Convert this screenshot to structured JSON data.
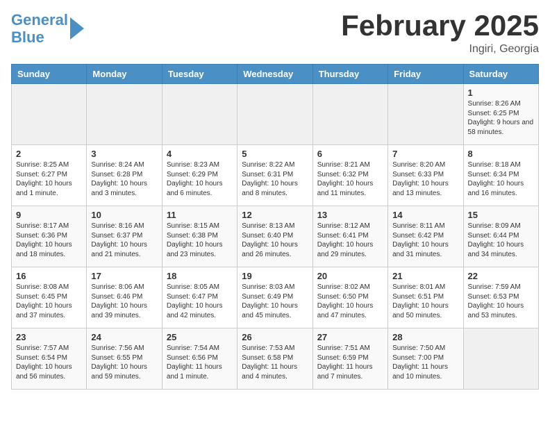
{
  "header": {
    "logo_line1": "General",
    "logo_line2": "Blue",
    "month": "February 2025",
    "location": "Ingiri, Georgia"
  },
  "days_of_week": [
    "Sunday",
    "Monday",
    "Tuesday",
    "Wednesday",
    "Thursday",
    "Friday",
    "Saturday"
  ],
  "weeks": [
    [
      {
        "num": "",
        "info": ""
      },
      {
        "num": "",
        "info": ""
      },
      {
        "num": "",
        "info": ""
      },
      {
        "num": "",
        "info": ""
      },
      {
        "num": "",
        "info": ""
      },
      {
        "num": "",
        "info": ""
      },
      {
        "num": "1",
        "info": "Sunrise: 8:26 AM\nSunset: 6:25 PM\nDaylight: 9 hours and 58 minutes."
      }
    ],
    [
      {
        "num": "2",
        "info": "Sunrise: 8:25 AM\nSunset: 6:27 PM\nDaylight: 10 hours and 1 minute."
      },
      {
        "num": "3",
        "info": "Sunrise: 8:24 AM\nSunset: 6:28 PM\nDaylight: 10 hours and 3 minutes."
      },
      {
        "num": "4",
        "info": "Sunrise: 8:23 AM\nSunset: 6:29 PM\nDaylight: 10 hours and 6 minutes."
      },
      {
        "num": "5",
        "info": "Sunrise: 8:22 AM\nSunset: 6:31 PM\nDaylight: 10 hours and 8 minutes."
      },
      {
        "num": "6",
        "info": "Sunrise: 8:21 AM\nSunset: 6:32 PM\nDaylight: 10 hours and 11 minutes."
      },
      {
        "num": "7",
        "info": "Sunrise: 8:20 AM\nSunset: 6:33 PM\nDaylight: 10 hours and 13 minutes."
      },
      {
        "num": "8",
        "info": "Sunrise: 8:18 AM\nSunset: 6:34 PM\nDaylight: 10 hours and 16 minutes."
      }
    ],
    [
      {
        "num": "9",
        "info": "Sunrise: 8:17 AM\nSunset: 6:36 PM\nDaylight: 10 hours and 18 minutes."
      },
      {
        "num": "10",
        "info": "Sunrise: 8:16 AM\nSunset: 6:37 PM\nDaylight: 10 hours and 21 minutes."
      },
      {
        "num": "11",
        "info": "Sunrise: 8:15 AM\nSunset: 6:38 PM\nDaylight: 10 hours and 23 minutes."
      },
      {
        "num": "12",
        "info": "Sunrise: 8:13 AM\nSunset: 6:40 PM\nDaylight: 10 hours and 26 minutes."
      },
      {
        "num": "13",
        "info": "Sunrise: 8:12 AM\nSunset: 6:41 PM\nDaylight: 10 hours and 29 minutes."
      },
      {
        "num": "14",
        "info": "Sunrise: 8:11 AM\nSunset: 6:42 PM\nDaylight: 10 hours and 31 minutes."
      },
      {
        "num": "15",
        "info": "Sunrise: 8:09 AM\nSunset: 6:44 PM\nDaylight: 10 hours and 34 minutes."
      }
    ],
    [
      {
        "num": "16",
        "info": "Sunrise: 8:08 AM\nSunset: 6:45 PM\nDaylight: 10 hours and 37 minutes."
      },
      {
        "num": "17",
        "info": "Sunrise: 8:06 AM\nSunset: 6:46 PM\nDaylight: 10 hours and 39 minutes."
      },
      {
        "num": "18",
        "info": "Sunrise: 8:05 AM\nSunset: 6:47 PM\nDaylight: 10 hours and 42 minutes."
      },
      {
        "num": "19",
        "info": "Sunrise: 8:03 AM\nSunset: 6:49 PM\nDaylight: 10 hours and 45 minutes."
      },
      {
        "num": "20",
        "info": "Sunrise: 8:02 AM\nSunset: 6:50 PM\nDaylight: 10 hours and 47 minutes."
      },
      {
        "num": "21",
        "info": "Sunrise: 8:01 AM\nSunset: 6:51 PM\nDaylight: 10 hours and 50 minutes."
      },
      {
        "num": "22",
        "info": "Sunrise: 7:59 AM\nSunset: 6:53 PM\nDaylight: 10 hours and 53 minutes."
      }
    ],
    [
      {
        "num": "23",
        "info": "Sunrise: 7:57 AM\nSunset: 6:54 PM\nDaylight: 10 hours and 56 minutes."
      },
      {
        "num": "24",
        "info": "Sunrise: 7:56 AM\nSunset: 6:55 PM\nDaylight: 10 hours and 59 minutes."
      },
      {
        "num": "25",
        "info": "Sunrise: 7:54 AM\nSunset: 6:56 PM\nDaylight: 11 hours and 1 minute."
      },
      {
        "num": "26",
        "info": "Sunrise: 7:53 AM\nSunset: 6:58 PM\nDaylight: 11 hours and 4 minutes."
      },
      {
        "num": "27",
        "info": "Sunrise: 7:51 AM\nSunset: 6:59 PM\nDaylight: 11 hours and 7 minutes."
      },
      {
        "num": "28",
        "info": "Sunrise: 7:50 AM\nSunset: 7:00 PM\nDaylight: 11 hours and 10 minutes."
      },
      {
        "num": "",
        "info": ""
      }
    ]
  ]
}
